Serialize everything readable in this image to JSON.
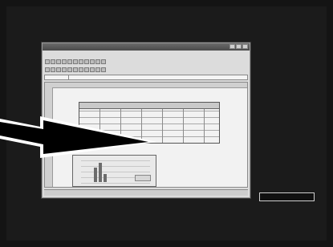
{
  "window": {
    "title": "",
    "menu_items": [],
    "formula": {
      "name_box": ""
    },
    "sheet_tabs": []
  },
  "overlay": {
    "caption_text": ""
  },
  "colors": {
    "background": "#111111",
    "window_gray": "#dcdcdc",
    "sheet_bg": "#f2f2f2",
    "accent": "#ffffff"
  },
  "icons": [
    "minimize-icon",
    "maximize-icon",
    "close-icon",
    "arrow-pointer-icon"
  ]
}
